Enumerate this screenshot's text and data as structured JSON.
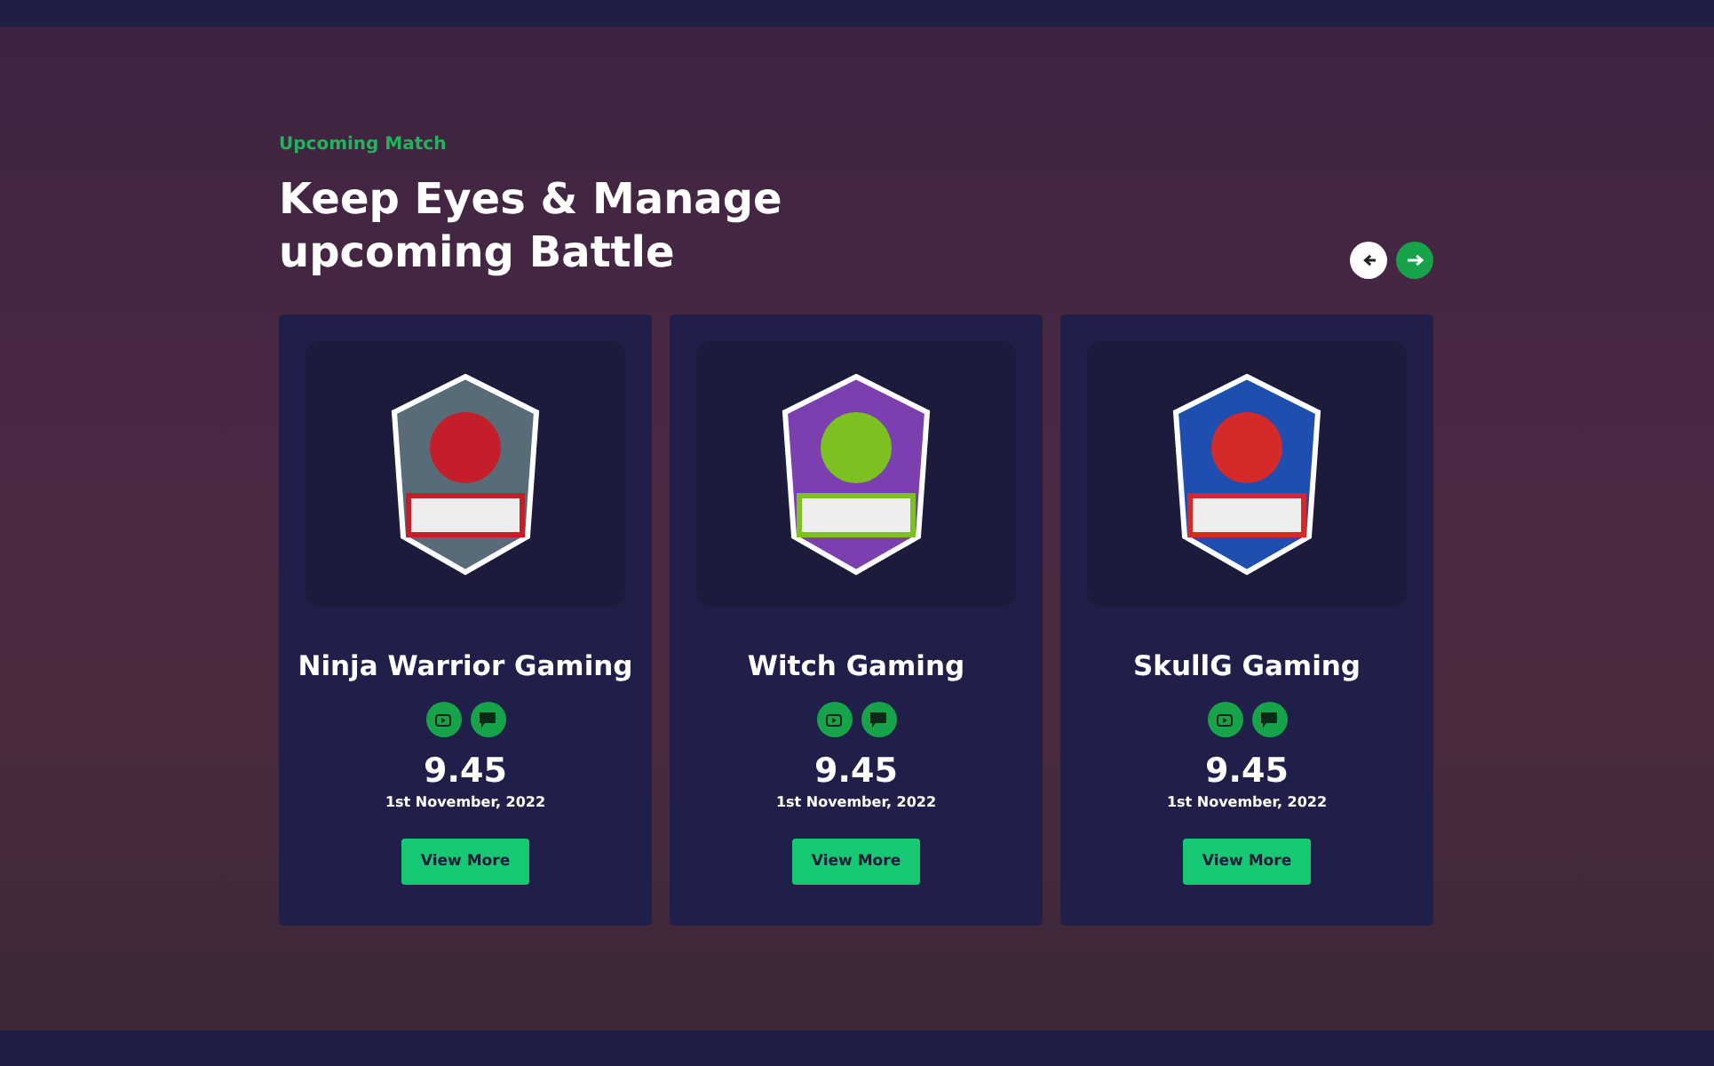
{
  "section": {
    "eyebrow": "Upcoming Match",
    "title_lines": [
      "Keep Eyes & Manage",
      "upcoming Battle"
    ]
  },
  "carousel": {
    "arrows": [
      {
        "kind": "prev",
        "selected": false
      },
      {
        "kind": "next",
        "selected": true
      }
    ]
  },
  "teams": [
    {
      "name": "Ninja Warrior Gaming",
      "kind": "ninja",
      "score": "9.45",
      "date": "1st November, 2022",
      "button": "View More"
    },
    {
      "name": "Witch Gaming",
      "kind": "witch",
      "score": "9.45",
      "date": "1st November, 2022",
      "button": "View More"
    },
    {
      "name": "SkullG Gaming",
      "kind": "skull",
      "score": "9.45",
      "date": "1st November, 2022",
      "button": "View More"
    }
  ]
}
